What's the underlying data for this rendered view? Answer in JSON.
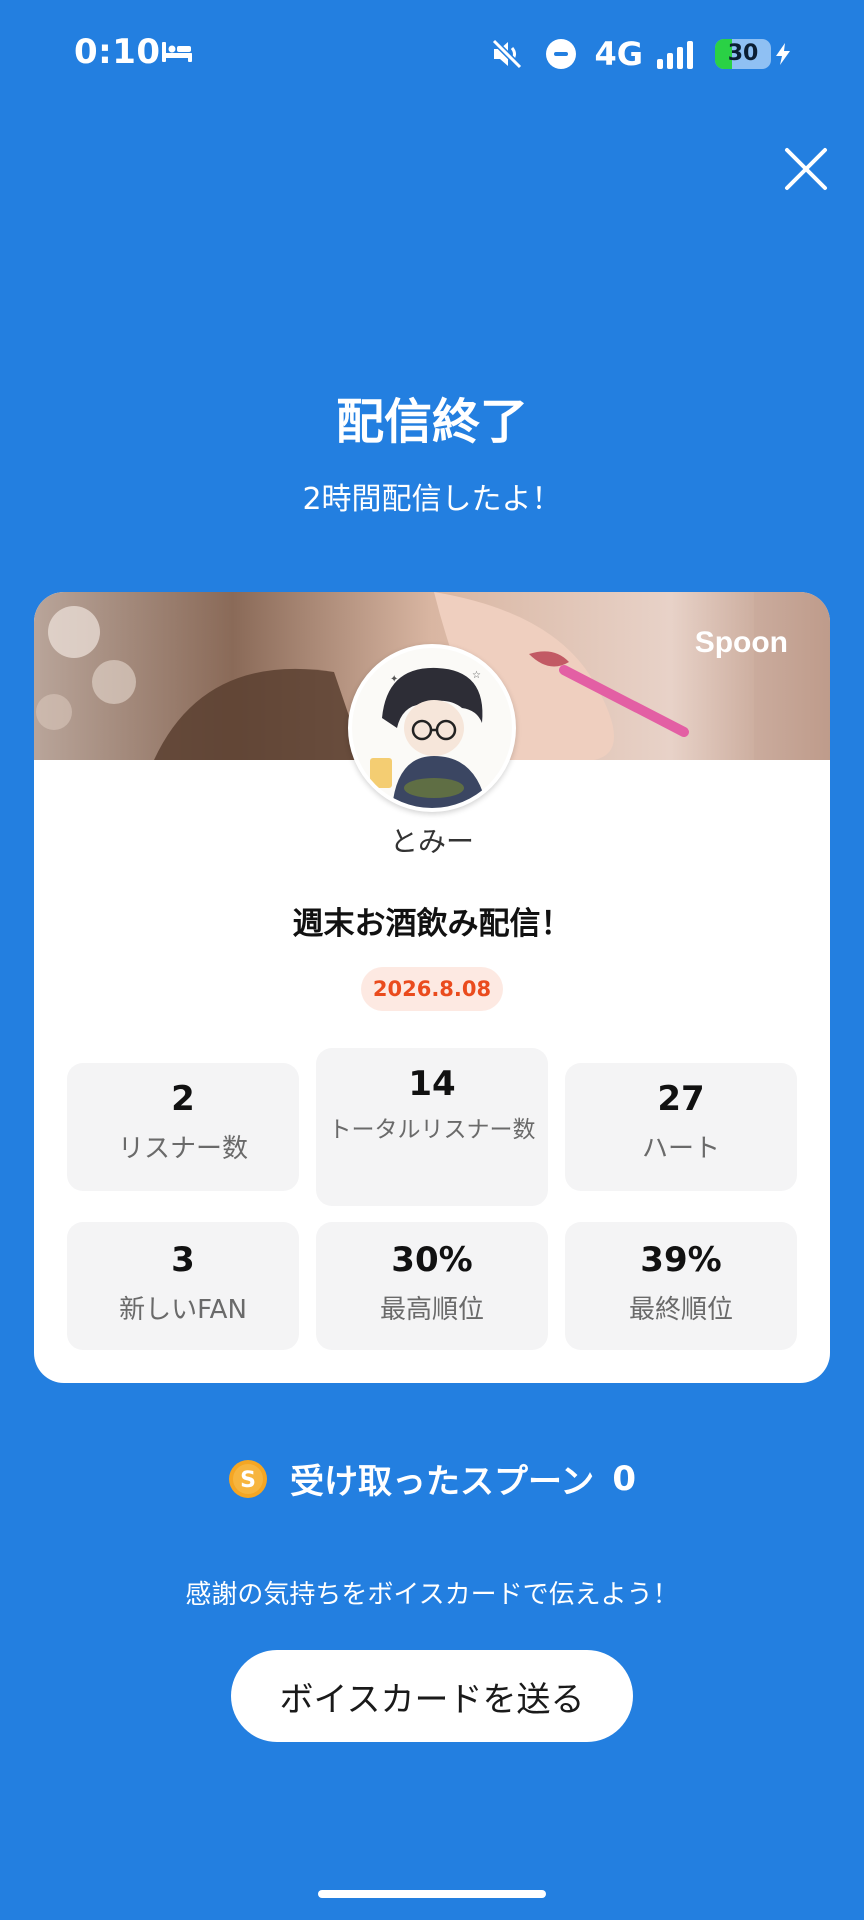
{
  "status_bar": {
    "time": "0:10",
    "network": "4G",
    "battery": "30",
    "battery_level": 0.3,
    "icons": [
      "bed-icon",
      "mute-icon",
      "do-not-disturb-icon",
      "signal-icon",
      "battery-icon",
      "charging-icon"
    ]
  },
  "header": {
    "title": "配信終了",
    "subtitle": "2時間配信したよ！"
  },
  "card": {
    "brand": "Spoon",
    "username": "とみー",
    "show_title": "週末お酒飲み配信！",
    "date": "2026.8.08",
    "stats": [
      {
        "value": "2",
        "label": "リスナー数"
      },
      {
        "value": "14",
        "label": "トータルリスナー数"
      },
      {
        "value": "27",
        "label": "ハート"
      },
      {
        "value": "3",
        "label": "新しいFAN"
      },
      {
        "value": "30%",
        "label": "最高順位"
      },
      {
        "value": "39%",
        "label": "最終順位"
      }
    ]
  },
  "spoons": {
    "label": "受け取ったスプーン",
    "count": "0"
  },
  "footer": {
    "thanks_text": "感謝の気持ちをボイスカードで伝えよう！",
    "voice_card_button": "ボイスカードを送る"
  },
  "colors": {
    "background": "#237fe0",
    "card": "#ffffff",
    "stat_tile": "#f4f4f5",
    "date_badge_bg": "#fde9e2",
    "date_badge_text": "#ea4b1d",
    "spoon_coin": "#f5a623"
  }
}
